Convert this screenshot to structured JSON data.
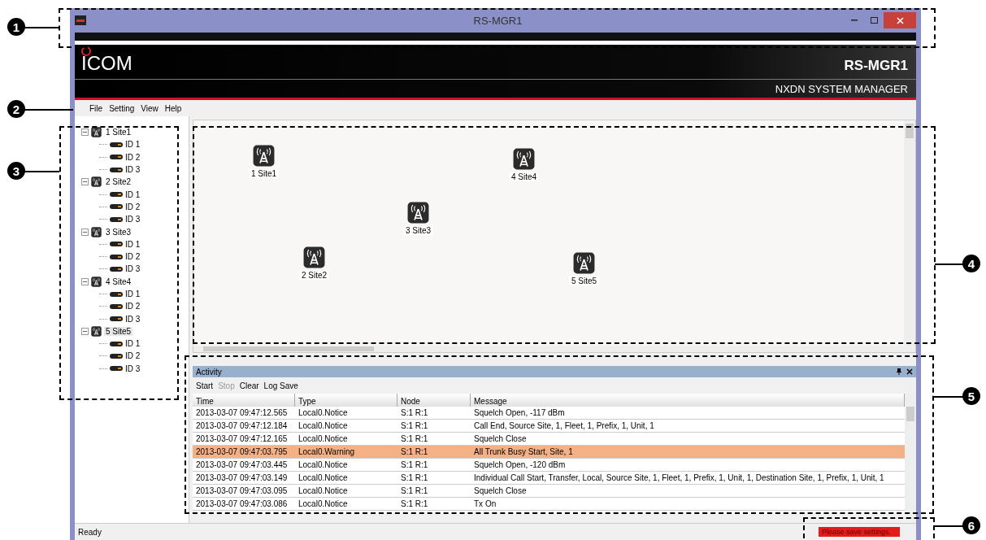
{
  "window": {
    "title": "RS-MGR1"
  },
  "banner": {
    "logo": "ICOM",
    "product": "RS-MGR1",
    "subtitle": "NXDN SYSTEM MANAGER"
  },
  "menu": [
    "File",
    "Setting",
    "View",
    "Help"
  ],
  "tree": [
    {
      "label": "1 Site1",
      "expanded": true,
      "selected": false,
      "children": [
        {
          "label": "ID 1"
        },
        {
          "label": "ID 2"
        },
        {
          "label": "ID 3"
        }
      ]
    },
    {
      "label": "2 Site2",
      "expanded": true,
      "selected": false,
      "children": [
        {
          "label": "ID 1"
        },
        {
          "label": "ID 2"
        },
        {
          "label": "ID 3"
        }
      ]
    },
    {
      "label": "3 Site3",
      "expanded": true,
      "selected": false,
      "children": [
        {
          "label": "ID 1"
        },
        {
          "label": "ID 2"
        },
        {
          "label": "ID 3"
        }
      ]
    },
    {
      "label": "4 Site4",
      "expanded": true,
      "selected": false,
      "children": [
        {
          "label": "ID 1"
        },
        {
          "label": "ID 2"
        },
        {
          "label": "ID 3"
        }
      ]
    },
    {
      "label": "5 Site5",
      "expanded": true,
      "selected": true,
      "children": [
        {
          "label": "ID 1"
        },
        {
          "label": "ID 2"
        },
        {
          "label": "ID 3"
        }
      ]
    }
  ],
  "map_sites": [
    "1 Site1",
    "2 Site2",
    "3 Site3",
    "4 Site4",
    "5 Site5"
  ],
  "activity": {
    "title": "Activity",
    "toolbar": [
      {
        "label": "Start",
        "disabled": false
      },
      {
        "label": "Stop",
        "disabled": true
      },
      {
        "label": "Clear",
        "disabled": false
      },
      {
        "label": "Log Save",
        "disabled": false
      }
    ],
    "columns": [
      "Time",
      "Type",
      "Node",
      "Message"
    ],
    "rows": [
      {
        "cells": [
          "2013-03-07 09:47:12.565",
          "Local0.Notice",
          "S:1 R:1",
          "Squelch Open, -117 dBm"
        ],
        "kind": "notice"
      },
      {
        "cells": [
          "2013-03-07 09:47:12.184",
          "Local0.Notice",
          "S:1 R:1",
          "Call End, Source Site, 1, Fleet, 1, Prefix, 1, Unit, 1"
        ],
        "kind": "notice"
      },
      {
        "cells": [
          "2013-03-07 09:47:12.165",
          "Local0.Notice",
          "S:1 R:1",
          "Squelch Close"
        ],
        "kind": "notice"
      },
      {
        "cells": [
          "2013-03-07 09:47:03.795",
          "Local0.Warning",
          "S:1 R:1",
          "All Trunk Busy Start, Site, 1"
        ],
        "kind": "warning"
      },
      {
        "cells": [
          "2013-03-07 09:47:03.445",
          "Local0.Notice",
          "S:1 R:1",
          "Squelch Open, -120 dBm"
        ],
        "kind": "notice"
      },
      {
        "cells": [
          "2013-03-07 09:47:03.149",
          "Local0.Notice",
          "S:1 R:1",
          "Individual Call Start, Transfer, Local, Source Site, 1, Fleet, 1, Prefix, 1, Unit, 1, Destination Site, 1, Prefix, 1, Unit, 1"
        ],
        "kind": "notice"
      },
      {
        "cells": [
          "2013-03-07 09:47:03.095",
          "Local0.Notice",
          "S:1 R:1",
          "Squelch Close"
        ],
        "kind": "notice"
      },
      {
        "cells": [
          "2013-03-07 09:47:03.086",
          "Local0.Notice",
          "S:1 R:1",
          "Tx On"
        ],
        "kind": "notice"
      }
    ]
  },
  "status_bar": {
    "text": "Ready",
    "warning": "Please save settings."
  },
  "callouts": [
    "1",
    "2",
    "3",
    "4",
    "5",
    "6"
  ]
}
